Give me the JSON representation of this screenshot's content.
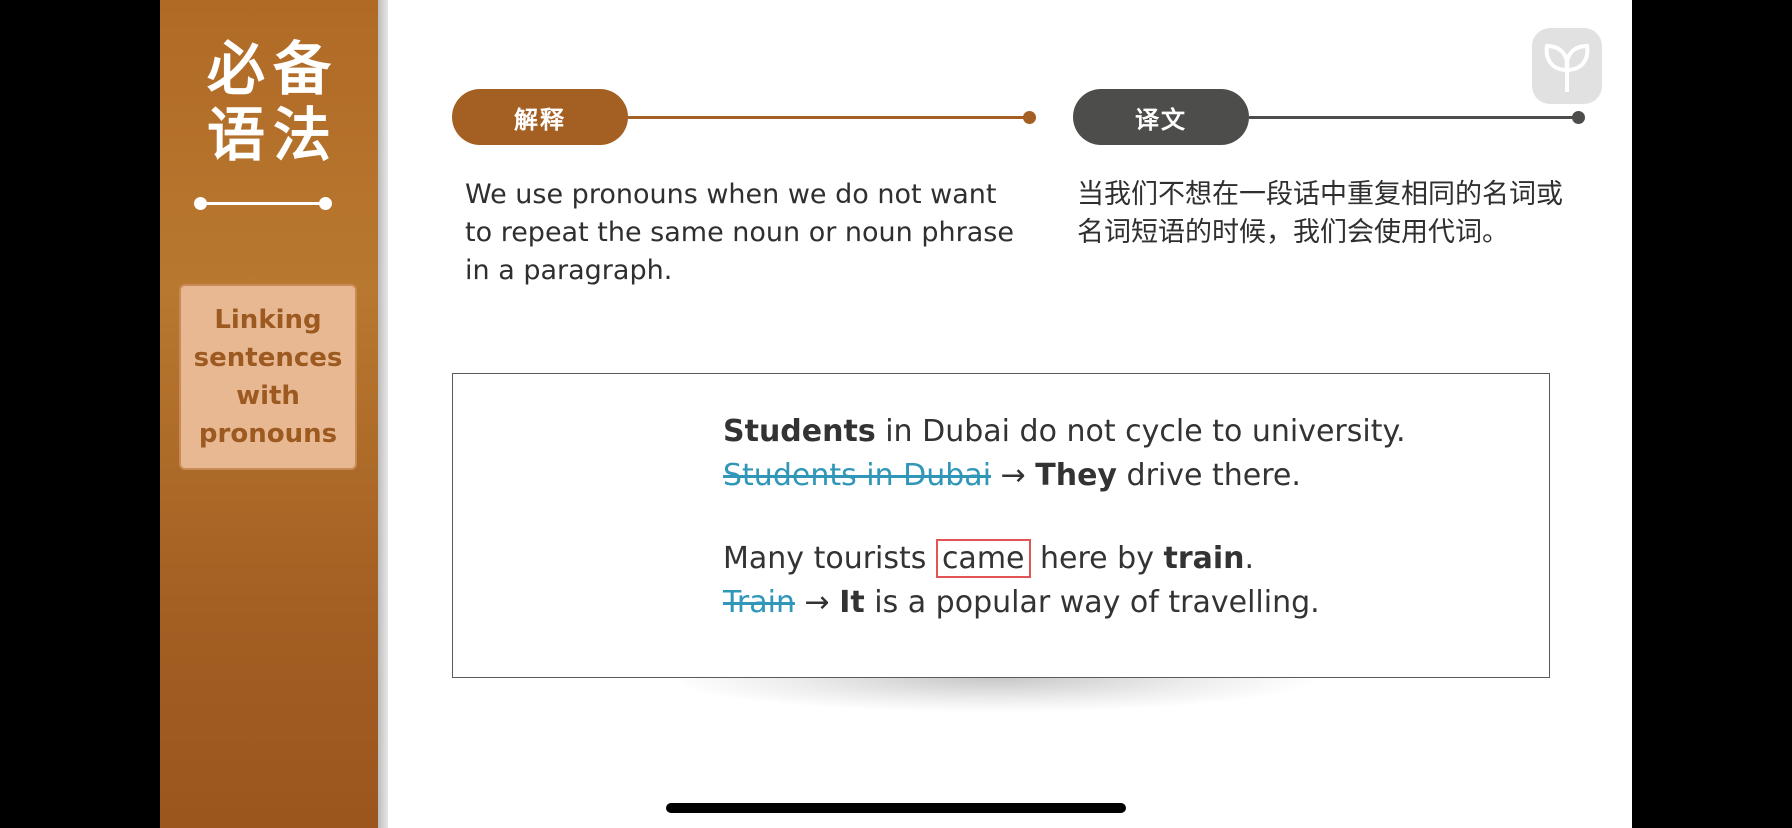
{
  "sidebar": {
    "title_line1": "必备",
    "title_line2": "语法",
    "topic": "Linking sentences with pronouns"
  },
  "headers": {
    "explanation_label": "解释",
    "translation_label": "译文"
  },
  "explanation_text": "We use pronouns when we do not want to repeat the same noun or noun phrase in a paragraph.",
  "translation_text": "当我们不想在一段话中重复相同的名词或名词短语的时候，我们会使用代词。",
  "examples": {
    "ex1_line1_bold": "Students",
    "ex1_line1_rest": " in Dubai do not cycle to university.",
    "ex1_line2_struck": "Students in Dubai",
    "ex1_line2_arrow": " → ",
    "ex1_line2_bold": "They",
    "ex1_line2_rest": " drive there.",
    "ex2_line1_pre": "Many tourists ",
    "ex2_line1_boxed": "came",
    "ex2_line1_mid": " here by ",
    "ex2_line1_bold": "train",
    "ex2_line1_end": ".",
    "ex2_line2_struck": "Train",
    "ex2_line2_arrow": " → ",
    "ex2_line2_bold": "It",
    "ex2_line2_rest": " is a popular way of travelling."
  },
  "colors": {
    "brand_brown": "#a45f22",
    "dark_gray": "#4d4d4b",
    "struck_blue": "#3097b8",
    "highlight_red": "#e25557"
  },
  "icons": {
    "logo": "sprout-logo-icon"
  }
}
